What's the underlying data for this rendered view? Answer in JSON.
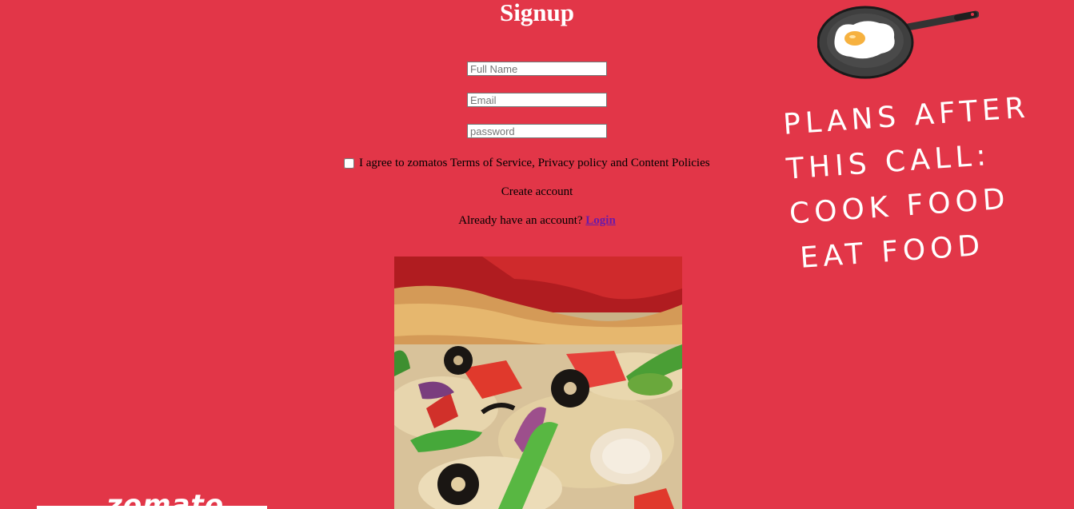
{
  "form": {
    "title": "Signup",
    "full_name_placeholder": "Full Name",
    "email_placeholder": "Email",
    "password_placeholder": "password",
    "agree_text": "I agree to zomatos Terms of Service, Privacy policy and Content Policies",
    "create_label": "Create account",
    "already_text": "Already have an account?",
    "login_label": "Login"
  },
  "poster": {
    "lines": [
      "PLANS AFTER",
      "THIS CALL:",
      "COOK FOOD",
      "EAT FOOD"
    ]
  },
  "brand": {
    "logo_text": "zomato"
  },
  "colors": {
    "background": "#e23648",
    "link": "#6b1aa8"
  }
}
